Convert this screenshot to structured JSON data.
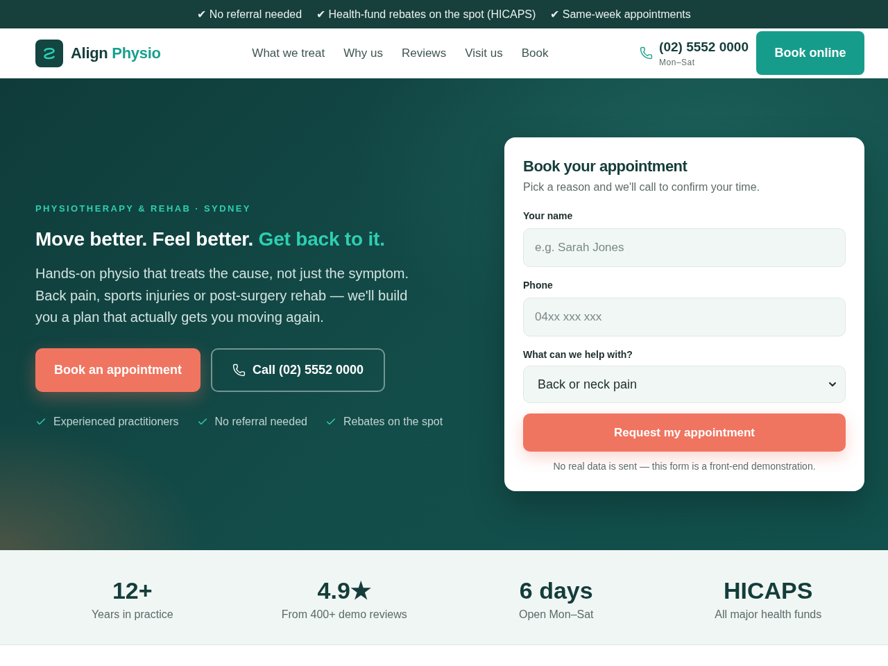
{
  "announcement_bar": {
    "items": [
      "✔ No referral needed",
      "✔ Health-fund rebates on the spot (HICAPS)",
      "✔ Same-week appointments"
    ]
  },
  "header": {
    "logo": {
      "name": "Align",
      "accent": "Physio"
    },
    "nav": [
      "What we treat",
      "Why us",
      "Reviews",
      "Visit us",
      "Book"
    ],
    "phone": {
      "number": "(02) 5552 0000",
      "hours": "Mon–Sat"
    },
    "cta": "Book online"
  },
  "hero": {
    "eyebrow": "PHYSIOTHERAPY & REHAB · SYDNEY",
    "headline": "Move better. Feel better.",
    "headline_accent": "Get back to it.",
    "intro": "Hands-on physio that treats the cause, not just the symptom. Back pain, sports injuries or post-surgery rehab — we'll build you a plan that actually gets you moving again.",
    "buttons": [
      {
        "kind": "primary",
        "label": "Book an appointment"
      },
      {
        "kind": "call",
        "label": "Call (02) 5552 0000"
      }
    ],
    "highlights": [
      "Experienced practitioners",
      "No referral needed",
      "Rebates on the spot"
    ]
  },
  "booking_form": {
    "title": "Book your appointment",
    "subtitle": "Pick a reason and we'll call to confirm your time.",
    "fields": [
      {
        "kind": "text",
        "label": "Your name",
        "placeholder": "e.g. Sarah Jones"
      },
      {
        "kind": "text",
        "label": "Phone",
        "placeholder": "04xx xxx xxx"
      },
      {
        "kind": "select",
        "label": "What can we help with?",
        "value": "Back or neck pain"
      }
    ],
    "submit": "Request my appointment",
    "note": "No real data is sent — this form is a front-end demonstration."
  },
  "stats": [
    {
      "value": "12+",
      "label": "Years in practice"
    },
    {
      "value": "4.9★",
      "label": "From 400+ demo reviews"
    },
    {
      "value": "6 days",
      "label": "Open Mon–Sat"
    },
    {
      "value": "HICAPS",
      "label": "All major health funds"
    }
  ]
}
